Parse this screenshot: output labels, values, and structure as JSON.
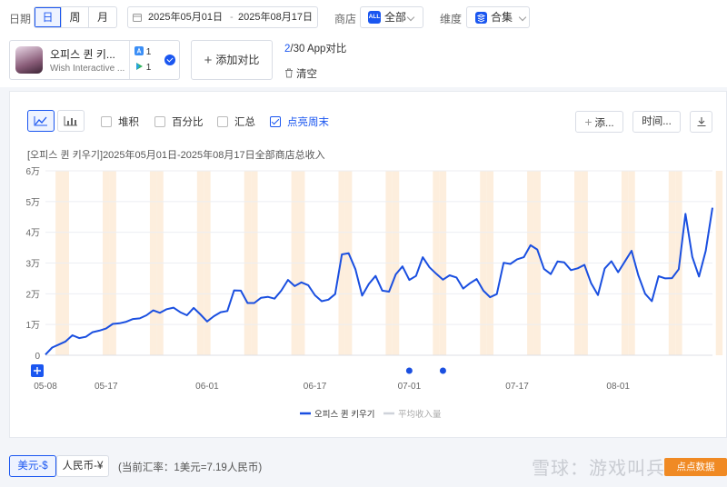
{
  "filters": {
    "date_label": "日期",
    "granularity": [
      "日",
      "周",
      "月"
    ],
    "granularity_selected": 0,
    "date_start": "2025年05月01日",
    "date_sep": "-",
    "date_end": "2025年08月17日",
    "store_label": "商店",
    "store_badge": "ALL",
    "store_value": "全部",
    "dimension_label": "维度",
    "dimension_value": "合集"
  },
  "app": {
    "name": "오피스 퀸 키...",
    "developer": "Wish Interactive ...",
    "ios_count": "1",
    "android_count": "1",
    "add_compare": "添加对比",
    "count_highlight": "2",
    "count_rest": "/30 App对比",
    "clear": "清空"
  },
  "toolbar": {
    "stack": "堆积",
    "percent": "百分比",
    "sum": "汇总",
    "weekend": "点亮周末",
    "add_short": "添...",
    "time_short": "时间..."
  },
  "chart_title": "[오피스 퀸 키우기]2025年05月01日-2025年08月17日全部商店总收入",
  "chart_data": {
    "type": "line",
    "title": "[오피스 퀸 키우기]2025年05月01日-2025年08月17日全部商店总收入",
    "x_start": "2025-05-08",
    "y_ticks": [
      "0",
      "1万",
      "2万",
      "3万",
      "4万",
      "5万",
      "6万"
    ],
    "ylim": [
      0,
      60000
    ],
    "x_tick_labels": [
      "05-08",
      "05-17",
      "06-01",
      "06-17",
      "07-01",
      "07-17",
      "08-01"
    ],
    "x_tick_indices": [
      0,
      9,
      24,
      40,
      54,
      70,
      85
    ],
    "weekend_indices": [
      2,
      3,
      9,
      10,
      16,
      17,
      23,
      24,
      30,
      31,
      37,
      38,
      44,
      45,
      51,
      52,
      58,
      59,
      65,
      66,
      72,
      73,
      79,
      80,
      86,
      87,
      93,
      94,
      100
    ],
    "event_marker_indices": [
      54,
      59
    ],
    "series": [
      {
        "name": "오피스 퀸 키우기",
        "color": "#1a4fe0",
        "values": [
          200,
          2500,
          3500,
          4500,
          6500,
          5600,
          6000,
          7500,
          8000,
          8700,
          10200,
          10400,
          10900,
          11800,
          12000,
          13000,
          14600,
          13800,
          15000,
          15500,
          14000,
          13000,
          15400,
          13300,
          11000,
          12700,
          14000,
          14400,
          21100,
          21000,
          17000,
          17000,
          18700,
          19000,
          18400,
          21000,
          24500,
          22500,
          23700,
          22800,
          19500,
          17600,
          18100,
          19900,
          32800,
          33200,
          28000,
          19400,
          23200,
          25800,
          21000,
          20700,
          26300,
          28900,
          24500,
          25800,
          31900,
          28600,
          26500,
          24600,
          26000,
          25300,
          21700,
          23400,
          24800,
          21000,
          18900,
          19900,
          30100,
          29700,
          31200,
          31900,
          35800,
          34400,
          28100,
          26400,
          30500,
          30200,
          27700,
          28300,
          29400,
          23400,
          19600,
          28200,
          30600,
          27000,
          30500,
          34000,
          26000,
          20000,
          17600,
          25700,
          25000,
          25100,
          28000,
          46000,
          32000,
          25600,
          34000,
          48000
        ]
      }
    ],
    "legend": [
      {
        "name": "오피스 퀸 키우기",
        "active": true
      },
      {
        "name": "平均收入量",
        "active": false
      }
    ]
  },
  "footer": {
    "usd": "美元-$",
    "cny": "人民币-¥",
    "rate": "(当前汇率：1美元=7.19人民币)",
    "watermark": "雪球：游戏叫兵",
    "badge": "点点数据"
  }
}
